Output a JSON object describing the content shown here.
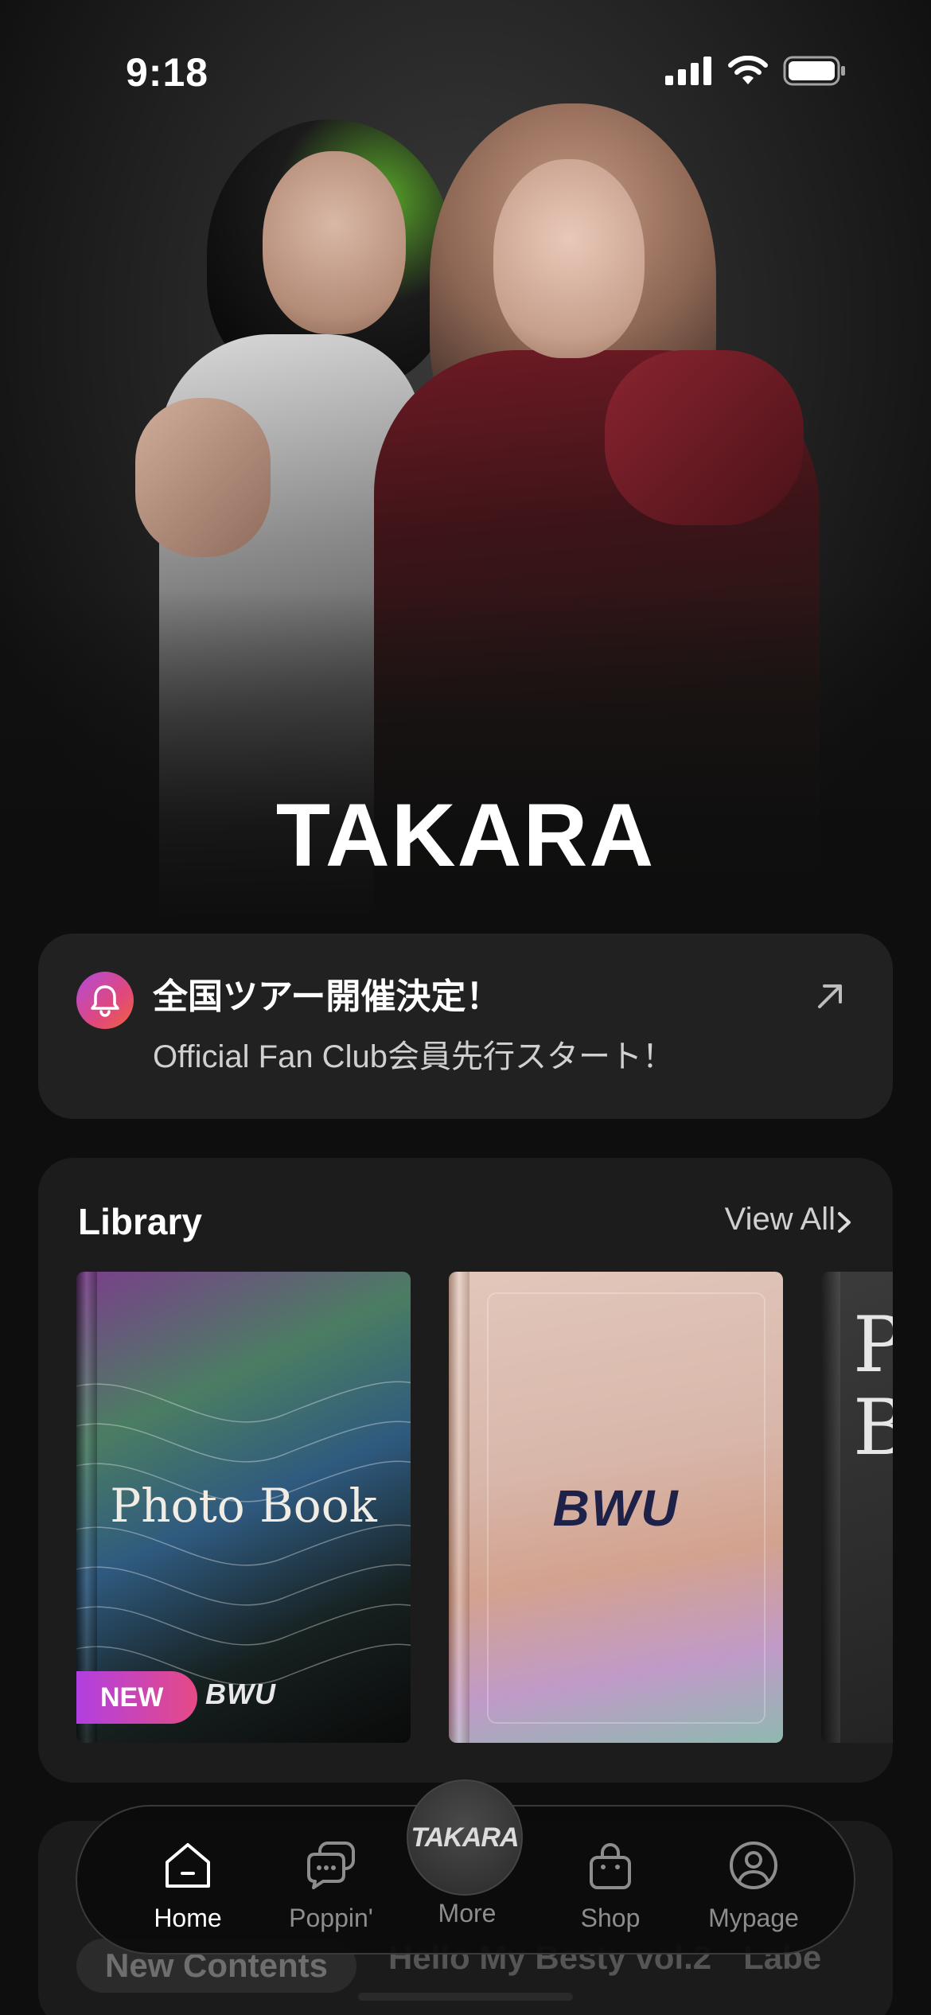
{
  "status_bar": {
    "time": "9:18"
  },
  "hero": {
    "artist_name": "TAKARA"
  },
  "news": {
    "headline": "全国ツアー開催決定！",
    "subtext": "Official Fan Club会員先行スタート！",
    "icon": "bell-icon",
    "action_icon": "arrow-up-right-icon"
  },
  "library": {
    "title": "Library",
    "view_all": "View All",
    "items": [
      {
        "title": "Photo Book",
        "badge": "NEW",
        "logo": "BWU"
      },
      {
        "logo": "BWU"
      },
      {
        "partial_title": "P\nB"
      }
    ]
  },
  "content_tabs": [
    "New Contents",
    "Hello My Besty vol.2",
    "Labe"
  ],
  "tabbar": {
    "items": [
      {
        "label": "Home",
        "icon": "home-icon",
        "active": true
      },
      {
        "label": "Poppin'",
        "icon": "chat-bubbles-icon",
        "active": false
      },
      {
        "label": "More",
        "icon": "takara-logo-icon",
        "active": false
      },
      {
        "label": "Shop",
        "icon": "shopping-bag-icon",
        "active": false
      },
      {
        "label": "Mypage",
        "icon": "user-circle-icon",
        "active": false
      }
    ],
    "center_logo": "TAKARA"
  },
  "colors": {
    "background": "#0e0e0e",
    "card": "#212121",
    "accent_gradient_start": "#b14bdc",
    "accent_gradient_end": "#f0623f",
    "inactive_tab": "#8d8d8d"
  }
}
